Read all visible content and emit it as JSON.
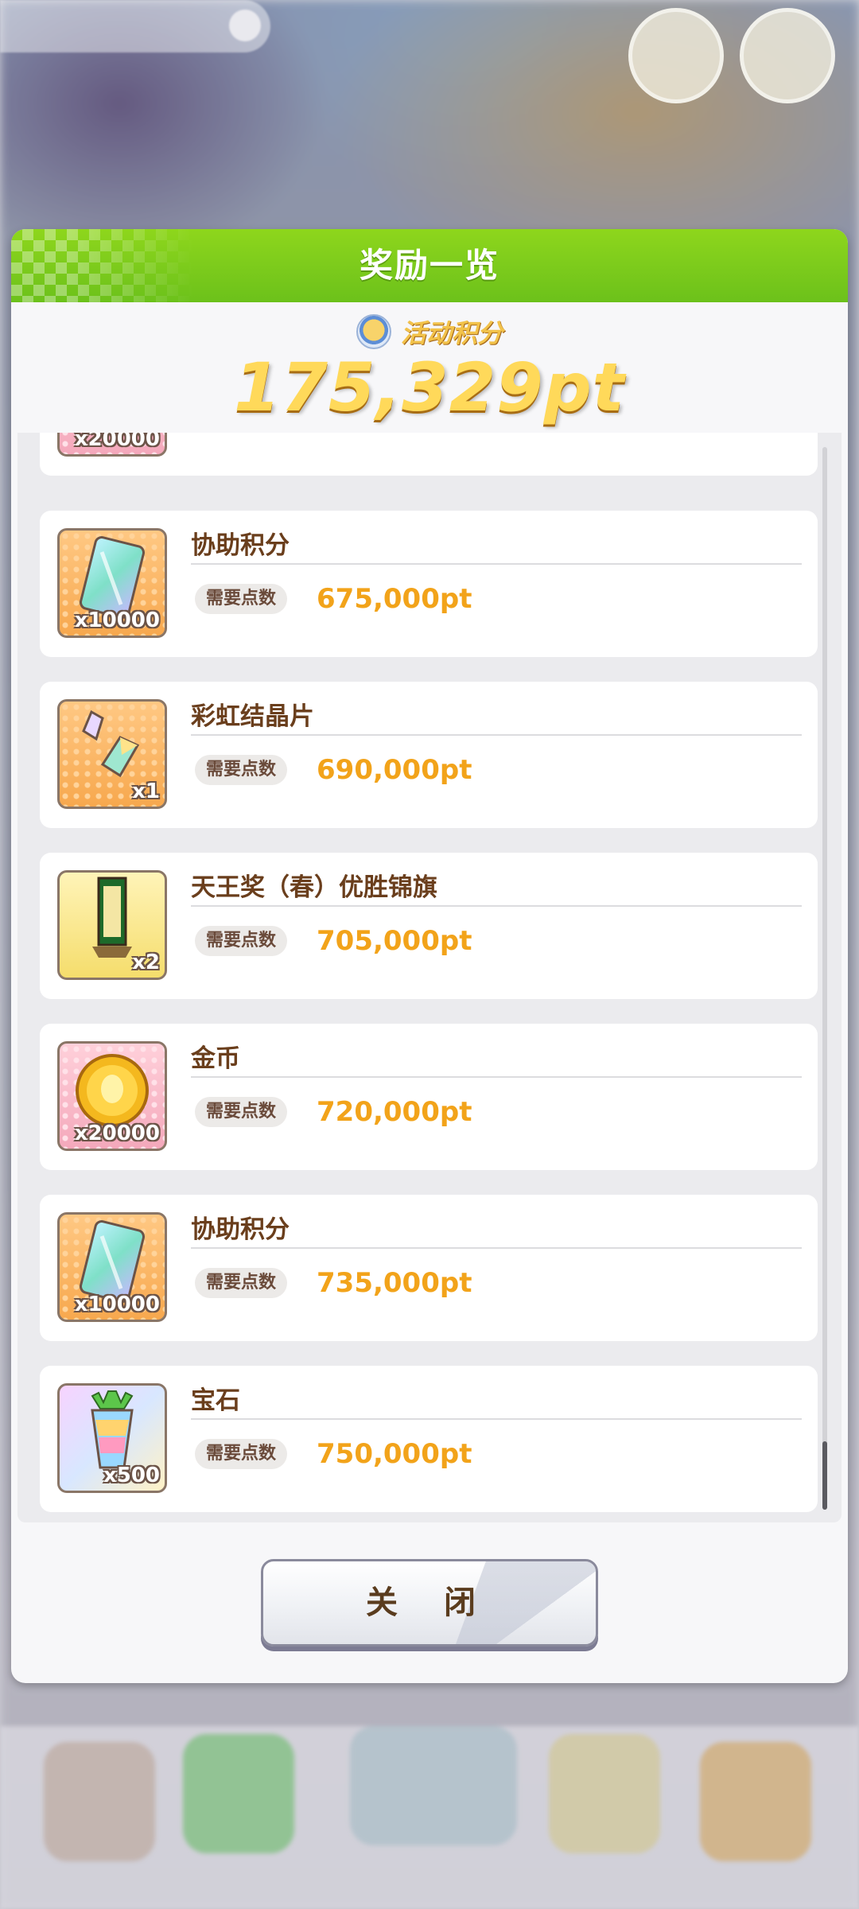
{
  "dialog": {
    "title": "奖励一览",
    "points_label": "活动积分",
    "points_value": "175,329pt",
    "close_label": "关 闭"
  },
  "partial_item": {
    "qty": "x20000"
  },
  "items": [
    {
      "name": "协助积分",
      "req_label": "需要点数",
      "req_value": "675,000pt",
      "qty": "x10000",
      "icon": "support-card-icon",
      "bg": "orange"
    },
    {
      "name": "彩虹结晶片",
      "req_label": "需要点数",
      "req_value": "690,000pt",
      "qty": "x1",
      "icon": "rainbow-crystal-icon",
      "bg": "orange"
    },
    {
      "name": "天王奖（春）优胜锦旗",
      "req_label": "需要点数",
      "req_value": "705,000pt",
      "qty": "x2",
      "icon": "pennant-icon",
      "bg": "yellow"
    },
    {
      "name": "金币",
      "req_label": "需要点数",
      "req_value": "720,000pt",
      "qty": "x20000",
      "icon": "gold-coin-icon",
      "bg": "pink"
    },
    {
      "name": "协助积分",
      "req_label": "需要点数",
      "req_value": "735,000pt",
      "qty": "x10000",
      "icon": "support-card-icon",
      "bg": "orange"
    },
    {
      "name": "宝石",
      "req_label": "需要点数",
      "req_value": "750,000pt",
      "qty": "x500",
      "icon": "carrot-gem-icon",
      "bg": "rainbow"
    }
  ],
  "colors": {
    "header_green": "#7dcc1a",
    "req_value_orange": "#f2a31a",
    "item_name_brown": "#6a3e1c",
    "points_gold": "#ffd95a"
  }
}
